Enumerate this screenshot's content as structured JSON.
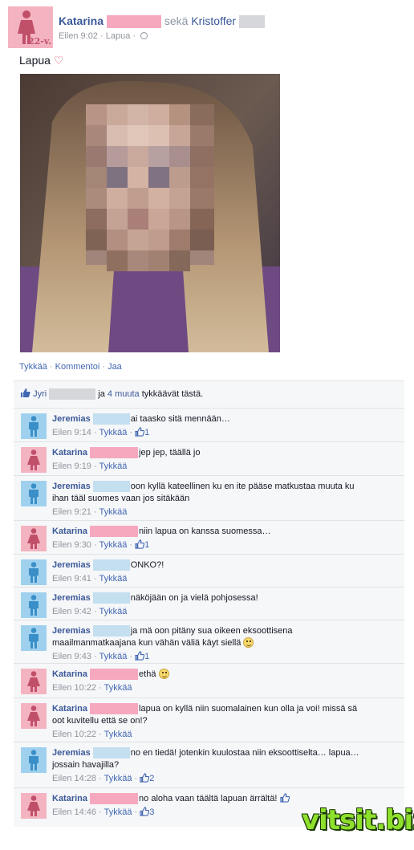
{
  "post": {
    "author_name": "Katarina",
    "joiner": "sekä",
    "tagged_name": "Kristoffer",
    "age_badge": "22-v.",
    "time": "Eilen 9:02",
    "location": "Lapua",
    "status_text": "Lapua",
    "status_emoji": "heart",
    "photo_description_icon": "pixelated-selfie-photo",
    "actions": {
      "like": "Tykkää",
      "comment": "Kommentoi",
      "share": "Jaa"
    },
    "likes": {
      "name": "Jyri",
      "connector": "ja",
      "others_link": "4 muuta",
      "suffix": "tykkäävät tästä."
    }
  },
  "comments": [
    {
      "author": "Jeremias",
      "gender": "male",
      "text": "ai taasko sitä mennään…",
      "time": "Eilen 9:14",
      "like": "Tykkää",
      "likes": "1"
    },
    {
      "author": "Katarina",
      "gender": "female",
      "text": "jep jep, täällä jo",
      "time": "Eilen 9:19",
      "like": "Tykkää",
      "likes": ""
    },
    {
      "author": "Jeremias",
      "gender": "male",
      "text": "oon kyllä kateellinen ku en ite pääse matkustaa muuta ku",
      "text2": "ihan tääl suomes vaan jos sitäkään",
      "time": "Eilen 9:21",
      "like": "Tykkää",
      "likes": ""
    },
    {
      "author": "Katarina",
      "gender": "female",
      "text": "niin lapua on kanssa suomessa…",
      "time": "Eilen 9:30",
      "like": "Tykkää",
      "likes": "1"
    },
    {
      "author": "Jeremias",
      "gender": "male",
      "text": "ONKO?!",
      "time": "Eilen 9:41",
      "like": "Tykkää",
      "likes": ""
    },
    {
      "author": "Jeremias",
      "gender": "male",
      "text": "näköjään on ja vielä pohjosessa!",
      "time": "Eilen 9:42",
      "like": "Tykkää",
      "likes": ""
    },
    {
      "author": "Jeremias",
      "gender": "male",
      "text": "ja mä oon pitäny sua oikeen eksoottisena",
      "text2": "maailmanmatkaajana kun vähän väliä käyt siellä",
      "time": "Eilen 9:43",
      "like": "Tykkää",
      "likes": "1"
    },
    {
      "author": "Katarina",
      "gender": "female",
      "text": "ethä",
      "time": "Eilen 10:22",
      "like": "Tykkää",
      "likes": ""
    },
    {
      "author": "Katarina",
      "gender": "female",
      "text": "lapua on kyllä niin suomalainen kun olla ja voi! missä sä",
      "text2": "oot kuvitellu että se on!?",
      "time": "Eilen 10:22",
      "like": "Tykkää",
      "likes": ""
    },
    {
      "author": "Jeremias",
      "gender": "male",
      "text": "no en tiedä! jotenkin kuulostaa niin eksoottiselta… lapua…",
      "text2": "jossain havajilla?",
      "time": "Eilen 14:28",
      "like": "Tykkää",
      "likes": "2"
    },
    {
      "author": "Katarina",
      "gender": "female",
      "text": "no aloha vaan täältä lapuan ärrältä!",
      "time": "Eilen 14:46",
      "like": "Tykkää",
      "likes": "3"
    }
  ],
  "watermark": "vitsit.biz"
}
